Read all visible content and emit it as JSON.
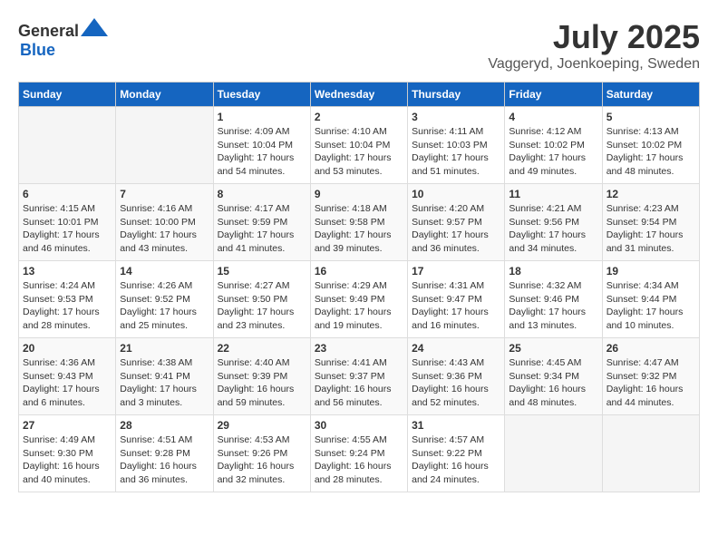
{
  "header": {
    "logo_general": "General",
    "logo_blue": "Blue",
    "month": "July 2025",
    "location": "Vaggeryd, Joenkoeping, Sweden"
  },
  "weekdays": [
    "Sunday",
    "Monday",
    "Tuesday",
    "Wednesday",
    "Thursday",
    "Friday",
    "Saturday"
  ],
  "weeks": [
    [
      {
        "day": "",
        "detail": ""
      },
      {
        "day": "",
        "detail": ""
      },
      {
        "day": "1",
        "detail": "Sunrise: 4:09 AM\nSunset: 10:04 PM\nDaylight: 17 hours\nand 54 minutes."
      },
      {
        "day": "2",
        "detail": "Sunrise: 4:10 AM\nSunset: 10:04 PM\nDaylight: 17 hours\nand 53 minutes."
      },
      {
        "day": "3",
        "detail": "Sunrise: 4:11 AM\nSunset: 10:03 PM\nDaylight: 17 hours\nand 51 minutes."
      },
      {
        "day": "4",
        "detail": "Sunrise: 4:12 AM\nSunset: 10:02 PM\nDaylight: 17 hours\nand 49 minutes."
      },
      {
        "day": "5",
        "detail": "Sunrise: 4:13 AM\nSunset: 10:02 PM\nDaylight: 17 hours\nand 48 minutes."
      }
    ],
    [
      {
        "day": "6",
        "detail": "Sunrise: 4:15 AM\nSunset: 10:01 PM\nDaylight: 17 hours\nand 46 minutes."
      },
      {
        "day": "7",
        "detail": "Sunrise: 4:16 AM\nSunset: 10:00 PM\nDaylight: 17 hours\nand 43 minutes."
      },
      {
        "day": "8",
        "detail": "Sunrise: 4:17 AM\nSunset: 9:59 PM\nDaylight: 17 hours\nand 41 minutes."
      },
      {
        "day": "9",
        "detail": "Sunrise: 4:18 AM\nSunset: 9:58 PM\nDaylight: 17 hours\nand 39 minutes."
      },
      {
        "day": "10",
        "detail": "Sunrise: 4:20 AM\nSunset: 9:57 PM\nDaylight: 17 hours\nand 36 minutes."
      },
      {
        "day": "11",
        "detail": "Sunrise: 4:21 AM\nSunset: 9:56 PM\nDaylight: 17 hours\nand 34 minutes."
      },
      {
        "day": "12",
        "detail": "Sunrise: 4:23 AM\nSunset: 9:54 PM\nDaylight: 17 hours\nand 31 minutes."
      }
    ],
    [
      {
        "day": "13",
        "detail": "Sunrise: 4:24 AM\nSunset: 9:53 PM\nDaylight: 17 hours\nand 28 minutes."
      },
      {
        "day": "14",
        "detail": "Sunrise: 4:26 AM\nSunset: 9:52 PM\nDaylight: 17 hours\nand 25 minutes."
      },
      {
        "day": "15",
        "detail": "Sunrise: 4:27 AM\nSunset: 9:50 PM\nDaylight: 17 hours\nand 23 minutes."
      },
      {
        "day": "16",
        "detail": "Sunrise: 4:29 AM\nSunset: 9:49 PM\nDaylight: 17 hours\nand 19 minutes."
      },
      {
        "day": "17",
        "detail": "Sunrise: 4:31 AM\nSunset: 9:47 PM\nDaylight: 17 hours\nand 16 minutes."
      },
      {
        "day": "18",
        "detail": "Sunrise: 4:32 AM\nSunset: 9:46 PM\nDaylight: 17 hours\nand 13 minutes."
      },
      {
        "day": "19",
        "detail": "Sunrise: 4:34 AM\nSunset: 9:44 PM\nDaylight: 17 hours\nand 10 minutes."
      }
    ],
    [
      {
        "day": "20",
        "detail": "Sunrise: 4:36 AM\nSunset: 9:43 PM\nDaylight: 17 hours\nand 6 minutes."
      },
      {
        "day": "21",
        "detail": "Sunrise: 4:38 AM\nSunset: 9:41 PM\nDaylight: 17 hours\nand 3 minutes."
      },
      {
        "day": "22",
        "detail": "Sunrise: 4:40 AM\nSunset: 9:39 PM\nDaylight: 16 hours\nand 59 minutes."
      },
      {
        "day": "23",
        "detail": "Sunrise: 4:41 AM\nSunset: 9:37 PM\nDaylight: 16 hours\nand 56 minutes."
      },
      {
        "day": "24",
        "detail": "Sunrise: 4:43 AM\nSunset: 9:36 PM\nDaylight: 16 hours\nand 52 minutes."
      },
      {
        "day": "25",
        "detail": "Sunrise: 4:45 AM\nSunset: 9:34 PM\nDaylight: 16 hours\nand 48 minutes."
      },
      {
        "day": "26",
        "detail": "Sunrise: 4:47 AM\nSunset: 9:32 PM\nDaylight: 16 hours\nand 44 minutes."
      }
    ],
    [
      {
        "day": "27",
        "detail": "Sunrise: 4:49 AM\nSunset: 9:30 PM\nDaylight: 16 hours\nand 40 minutes."
      },
      {
        "day": "28",
        "detail": "Sunrise: 4:51 AM\nSunset: 9:28 PM\nDaylight: 16 hours\nand 36 minutes."
      },
      {
        "day": "29",
        "detail": "Sunrise: 4:53 AM\nSunset: 9:26 PM\nDaylight: 16 hours\nand 32 minutes."
      },
      {
        "day": "30",
        "detail": "Sunrise: 4:55 AM\nSunset: 9:24 PM\nDaylight: 16 hours\nand 28 minutes."
      },
      {
        "day": "31",
        "detail": "Sunrise: 4:57 AM\nSunset: 9:22 PM\nDaylight: 16 hours\nand 24 minutes."
      },
      {
        "day": "",
        "detail": ""
      },
      {
        "day": "",
        "detail": ""
      }
    ]
  ]
}
